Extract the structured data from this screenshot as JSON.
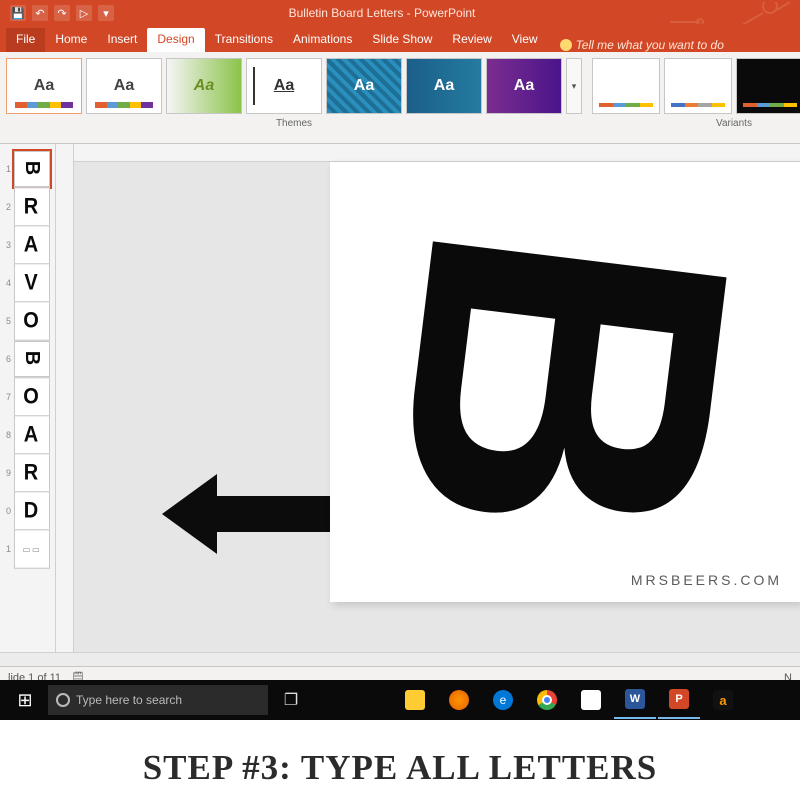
{
  "titlebar": {
    "title": "Bulletin Board Letters - PowerPoint"
  },
  "qat": {
    "save": "💾",
    "undo": "↶",
    "redo": "↷",
    "start": "▷",
    "more": "▾"
  },
  "tabs": {
    "file": "File",
    "home": "Home",
    "insert": "Insert",
    "design": "Design",
    "transitions": "Transitions",
    "animations": "Animations",
    "slideshow": "Slide Show",
    "review": "Review",
    "view": "View",
    "tellme": "Tell me what you want to do"
  },
  "ribbon": {
    "themes_label": "Themes",
    "variants_label": "Variants",
    "theme_sample": "Aa"
  },
  "slides": {
    "letters": [
      "B",
      "R",
      "A",
      "V",
      "O",
      "B",
      "O",
      "A",
      "R",
      "D"
    ],
    "selected_index": 0,
    "status": "lide 1 of 11",
    "notes_label": "N"
  },
  "canvas": {
    "watermark": "MRSBEERS.COM"
  },
  "taskbar": {
    "search_placeholder": "Type here to search"
  },
  "caption": "STEP #3: TYPE ALL LETTERS"
}
